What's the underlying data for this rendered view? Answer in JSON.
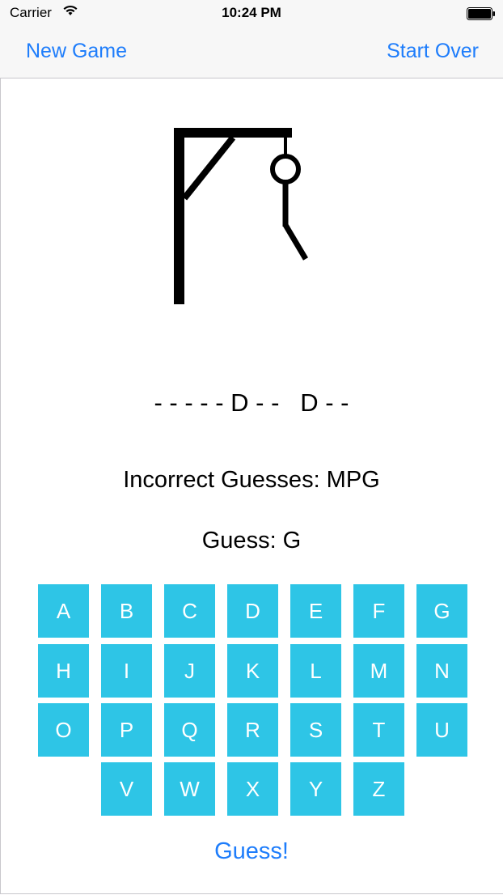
{
  "status_bar": {
    "carrier": "Carrier",
    "time": "10:24 PM",
    "wifi_icon": "wifi-icon",
    "battery_icon": "battery-icon"
  },
  "nav_bar": {
    "left_button": "New Game",
    "right_button": "Start Over"
  },
  "game": {
    "hangman_stage": "head-body-leg",
    "word_display": "- - - - - D - -   D - -",
    "incorrect_guesses": "Incorrect Guesses: MPG",
    "current_guess": "Guess: G"
  },
  "keyboard": {
    "rows": [
      [
        "A",
        "B",
        "C",
        "D",
        "E",
        "F",
        "G"
      ],
      [
        "H",
        "I",
        "J",
        "K",
        "L",
        "M",
        "N"
      ],
      [
        "O",
        "P",
        "Q",
        "R",
        "S",
        "T",
        "U"
      ],
      [
        "V",
        "W",
        "X",
        "Y",
        "Z"
      ]
    ]
  },
  "guess_button": "Guess!",
  "colors": {
    "tint": "#1e7dfb",
    "key_background": "#2ec5e6",
    "key_text": "#ffffff",
    "bar_background": "#f7f7f7"
  }
}
